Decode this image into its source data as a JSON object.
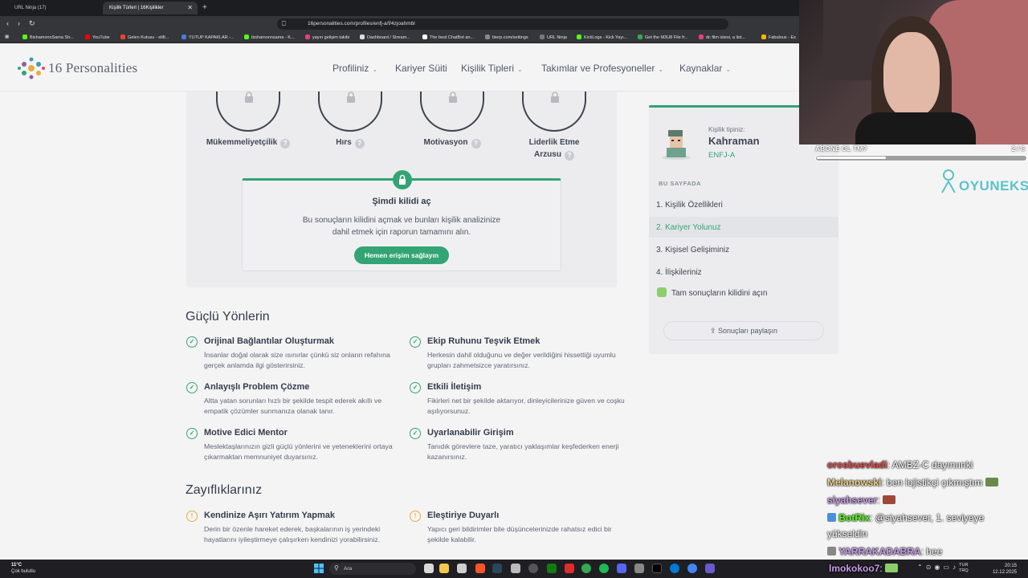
{
  "browser": {
    "tabs": [
      {
        "label": "URL Ninja (17)"
      },
      {
        "label": "Kişilik Türleri | 16Kişilikler",
        "active": true
      }
    ],
    "new_tab": "+",
    "url": "16personalities.com/profiles/enfj-a/f/4zjoahmbl",
    "bookmarks": [
      "BishamonnSama Str...",
      "YouTube",
      "Gelen Kutusu - elift...",
      "YUTUP KAPAKLAR -...",
      "bishamonnsama - K...",
      "yayın gelişim takibi",
      "Dashboard / Stream...",
      "The best ChatBot an...",
      "bierp.com/settings",
      "URL Ninja",
      "KickLogs - Kick Yayı...",
      "Get the M3U8 File fr...",
      "dc film istesi, a list...",
      "Fabulous - Ex"
    ]
  },
  "site": {
    "logo_text": "16 Personalities",
    "nav": [
      "Profiliniz",
      "Kariyer Süiti",
      "Kişilik Tipleri",
      "Takımlar ve Profesyoneller",
      "Kaynaklar"
    ]
  },
  "traits": [
    {
      "label": "Mükemmeliyetçilik"
    },
    {
      "label": "Hırs"
    },
    {
      "label": "Motivasyon"
    },
    {
      "label": "Liderlik Etme Arzusu"
    }
  ],
  "unlock": {
    "title": "Şimdi kilidi aç",
    "text": "Bu sonuçların kilidini açmak ve bunları kişilik analizinize dahil etmek için raporun tamamını alın.",
    "button": "Hemen erişim sağlayın"
  },
  "strengths": {
    "title": "Güçlü Yönlerin",
    "items": [
      {
        "title": "Orijinal Bağlantılar Oluşturmak",
        "desc": "İnsanlar doğal olarak size ısınırlar çünkü siz onların refahına gerçek anlamda ilgi gösterirsiniz."
      },
      {
        "title": "Ekip Ruhunu Teşvik Etmek",
        "desc": "Herkesin dahil olduğunu ve değer verildiğini hissettiği uyumlu grupları zahmetsizce yaratırsınız."
      },
      {
        "title": "Anlayışlı Problem Çözme",
        "desc": "Altta yatan sorunları hızlı bir şekilde tespit ederek akıllı ve empatik çözümler sunmanıza olanak tanır."
      },
      {
        "title": "Etkili İletişim",
        "desc": "Fikirleri net bir şekilde aktarıyor, dinleyicilerinize güven ve coşku aşılıyorsunuz."
      },
      {
        "title": "Motive Edici Mentor",
        "desc": "Meslektaşlarınızın gizli güçlü yönlerini ve yeteneklerini ortaya çıkarmaktan memnuniyet duyarsınız."
      },
      {
        "title": "Uyarlanabilir Girişim",
        "desc": "Tanıdık görevlere taze, yaratıcı yaklaşımlar keşfederken enerji kazanırsınız."
      }
    ]
  },
  "weaknesses": {
    "title": "Zayıflıklarınız",
    "items": [
      {
        "title": "Kendinize Aşırı Yatırım Yapmak",
        "desc": "Derin bir özenle hareket ederek, başkalarının iş yerindeki hayatlarını iyileştirmeye çalışırken kendinizi yorabilirsiniz."
      },
      {
        "title": "Eleştiriye Duyarlı",
        "desc": "Yapıcı geri bildirimler bile düşüncelerinizde rahatsız edici bir şekilde kalabilir."
      }
    ]
  },
  "sidebar": {
    "label": "Kişilik tipiniz:",
    "type": "Kahraman",
    "code": "ENFJ-A",
    "section": "BU SAYFADA",
    "links": [
      {
        "label": "1. Kişilik Özellikleri"
      },
      {
        "label": "2. Kariyer Yolunuz",
        "active": true
      },
      {
        "label": "3. Kişisel Gelişiminiz"
      },
      {
        "label": "4. İlişkileriniz"
      }
    ],
    "unlock_link": "Tam sonuçların kilidini açın",
    "share": "Sonuçları paylaşın"
  },
  "overlay": {
    "goal_label": "ABONE OL TM?",
    "goal_count": "2 / 6",
    "goal_progress": 0.33,
    "brand": "OYUNEKS",
    "chat": [
      {
        "name": "orosbuevladi",
        "color": "#e04b4b",
        "text": ": AMBZ-C dayınıınki"
      },
      {
        "name": "Melanowski",
        "color": "#f0d28a",
        "text": ": ben lojistikçi çıkmıştım"
      },
      {
        "name": "siyahsever",
        "color": "#c99be8",
        "text": ":"
      },
      {
        "name": "BotRix",
        "color": "#53fc18",
        "text": ": @siyahsever, 1. seviyeye"
      },
      {
        "name": "",
        "color": "#ffffff",
        "text": "yükseldin"
      },
      {
        "name": "YARRAKADABRA",
        "color": "#c99be8",
        "text": ": hee"
      },
      {
        "name": "lmokokoo7",
        "color": "#c99be8",
        "text": ":"
      }
    ]
  },
  "taskbar": {
    "temperature": "11°C",
    "weather": "Çok bulutlu",
    "search": "Ara",
    "lang_1": "TUR",
    "lang_2": "TRQ",
    "time": "20:15",
    "date": "12.12.2025"
  },
  "colors": {
    "accent": "#33a474",
    "warning": "#e4ae3a"
  }
}
